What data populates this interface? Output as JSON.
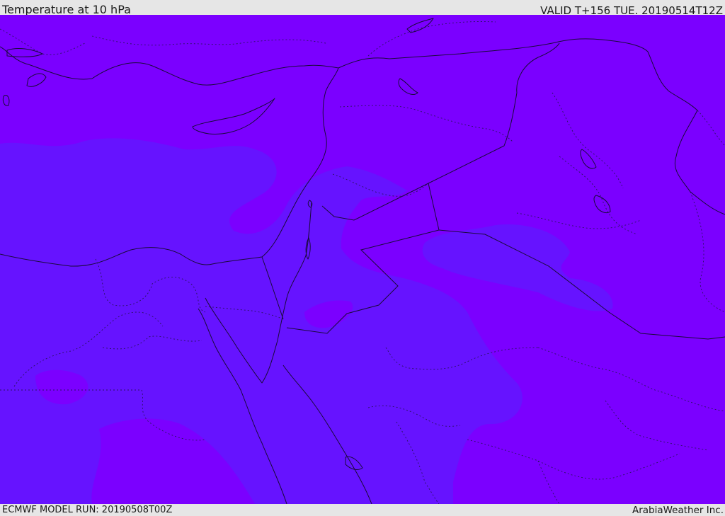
{
  "header": {
    "title": "Temperature at 10 hPa",
    "valid": "VALID T+156 TUE. 20190514T12Z"
  },
  "footer": {
    "model_run": "ECMWF MODEL RUN: 20190508T00Z",
    "credit": "ArabiaWeather Inc."
  },
  "colors": {
    "warmer_field": "#7b00ff",
    "colder_field": "#6613ff",
    "boundary_lines": "#1a0a3a",
    "bars": "#e6e6e6"
  }
}
